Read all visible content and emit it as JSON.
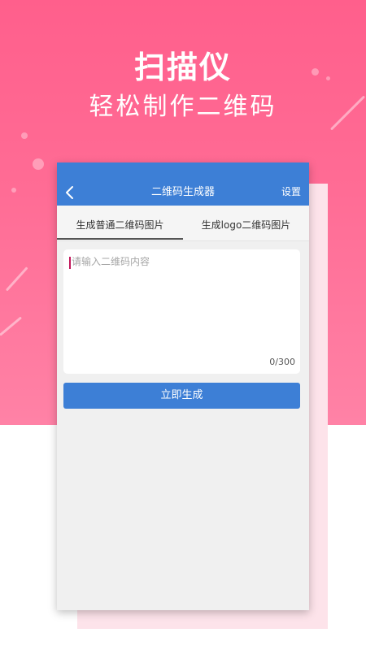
{
  "hero": {
    "title": "扫描仪",
    "subtitle": "轻松制作二维码"
  },
  "app_bar": {
    "back_icon": "chevron-left-icon",
    "title": "二维码生成器",
    "settings_label": "设置"
  },
  "tabs": [
    {
      "label": "生成普通二维码图片",
      "selected": true
    },
    {
      "label": "生成logo二维码图片",
      "selected": false
    }
  ],
  "input": {
    "value": "",
    "placeholder": "请输入二维码内容",
    "counter": "0/300"
  },
  "actions": {
    "generate_label": "立即生成"
  },
  "colors": {
    "hero_pink": "#ff6c95",
    "app_blue": "#3d7fd6",
    "caret": "#c2185b"
  }
}
